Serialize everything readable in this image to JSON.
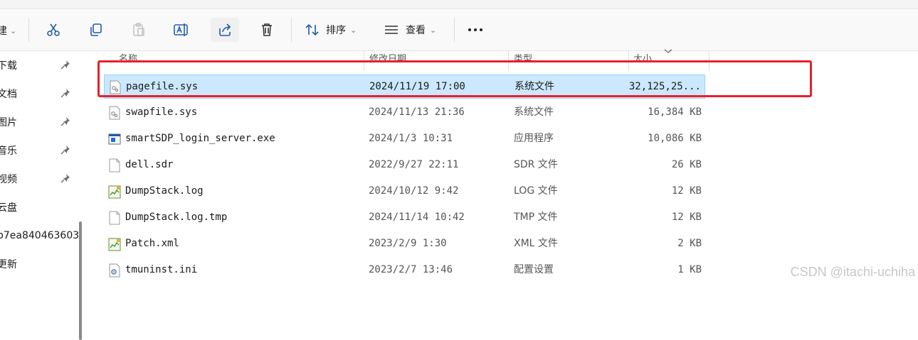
{
  "toolbar": {
    "new_label_partial": "建",
    "sort_label": "排序",
    "view_label": "查看",
    "more_label": "..."
  },
  "sidebar": {
    "items": [
      {
        "label": "下载",
        "pinned": true
      },
      {
        "label": "文档",
        "pinned": true
      },
      {
        "label": "图片",
        "pinned": true
      },
      {
        "label": "音乐",
        "pinned": true
      },
      {
        "label": "视频",
        "pinned": true
      },
      {
        "label": "云盘",
        "pinned": false
      },
      {
        "label": "b7ea840463603",
        "pinned": false
      },
      {
        "label": "更新",
        "pinned": false
      }
    ]
  },
  "columns": {
    "name": "名称",
    "date": "修改日期",
    "type": "类型",
    "size": "大小"
  },
  "files": [
    {
      "name": "pagefile.sys",
      "date": "2024/11/19 17:00",
      "type": "系统文件",
      "size": "32,125,25...",
      "icon": "system-file-icon",
      "selected": true
    },
    {
      "name": "swapfile.sys",
      "date": "2024/11/13 21:36",
      "type": "系统文件",
      "size": "16,384 KB",
      "icon": "system-file-icon",
      "selected": false
    },
    {
      "name": "smartSDP_login_server.exe",
      "date": "2024/1/3 10:31",
      "type": "应用程序",
      "size": "10,086 KB",
      "icon": "application-icon",
      "selected": false
    },
    {
      "name": "dell.sdr",
      "date": "2022/9/27 22:11",
      "type": "SDR 文件",
      "size": "26 KB",
      "icon": "blank-file-icon",
      "selected": false
    },
    {
      "name": "DumpStack.log",
      "date": "2024/10/12 9:42",
      "type": "LOG 文件",
      "size": "12 KB",
      "icon": "log-file-icon",
      "selected": false
    },
    {
      "name": "DumpStack.log.tmp",
      "date": "2024/11/14 10:42",
      "type": "TMP 文件",
      "size": "12 KB",
      "icon": "blank-file-icon",
      "selected": false
    },
    {
      "name": "Patch.xml",
      "date": "2023/2/9 1:30",
      "type": "XML 文件",
      "size": "2 KB",
      "icon": "xml-file-icon",
      "selected": false
    },
    {
      "name": "tmuninst.ini",
      "date": "2023/2/7 13:46",
      "type": "配置设置",
      "size": "1 KB",
      "icon": "settings-file-icon",
      "selected": false
    }
  ],
  "watermark": "CSDN @itachi-uchiha",
  "colors": {
    "selection_bg": "#cce8ff",
    "selection_border": "#99d1ff",
    "highlight_box": "#e8202a"
  }
}
